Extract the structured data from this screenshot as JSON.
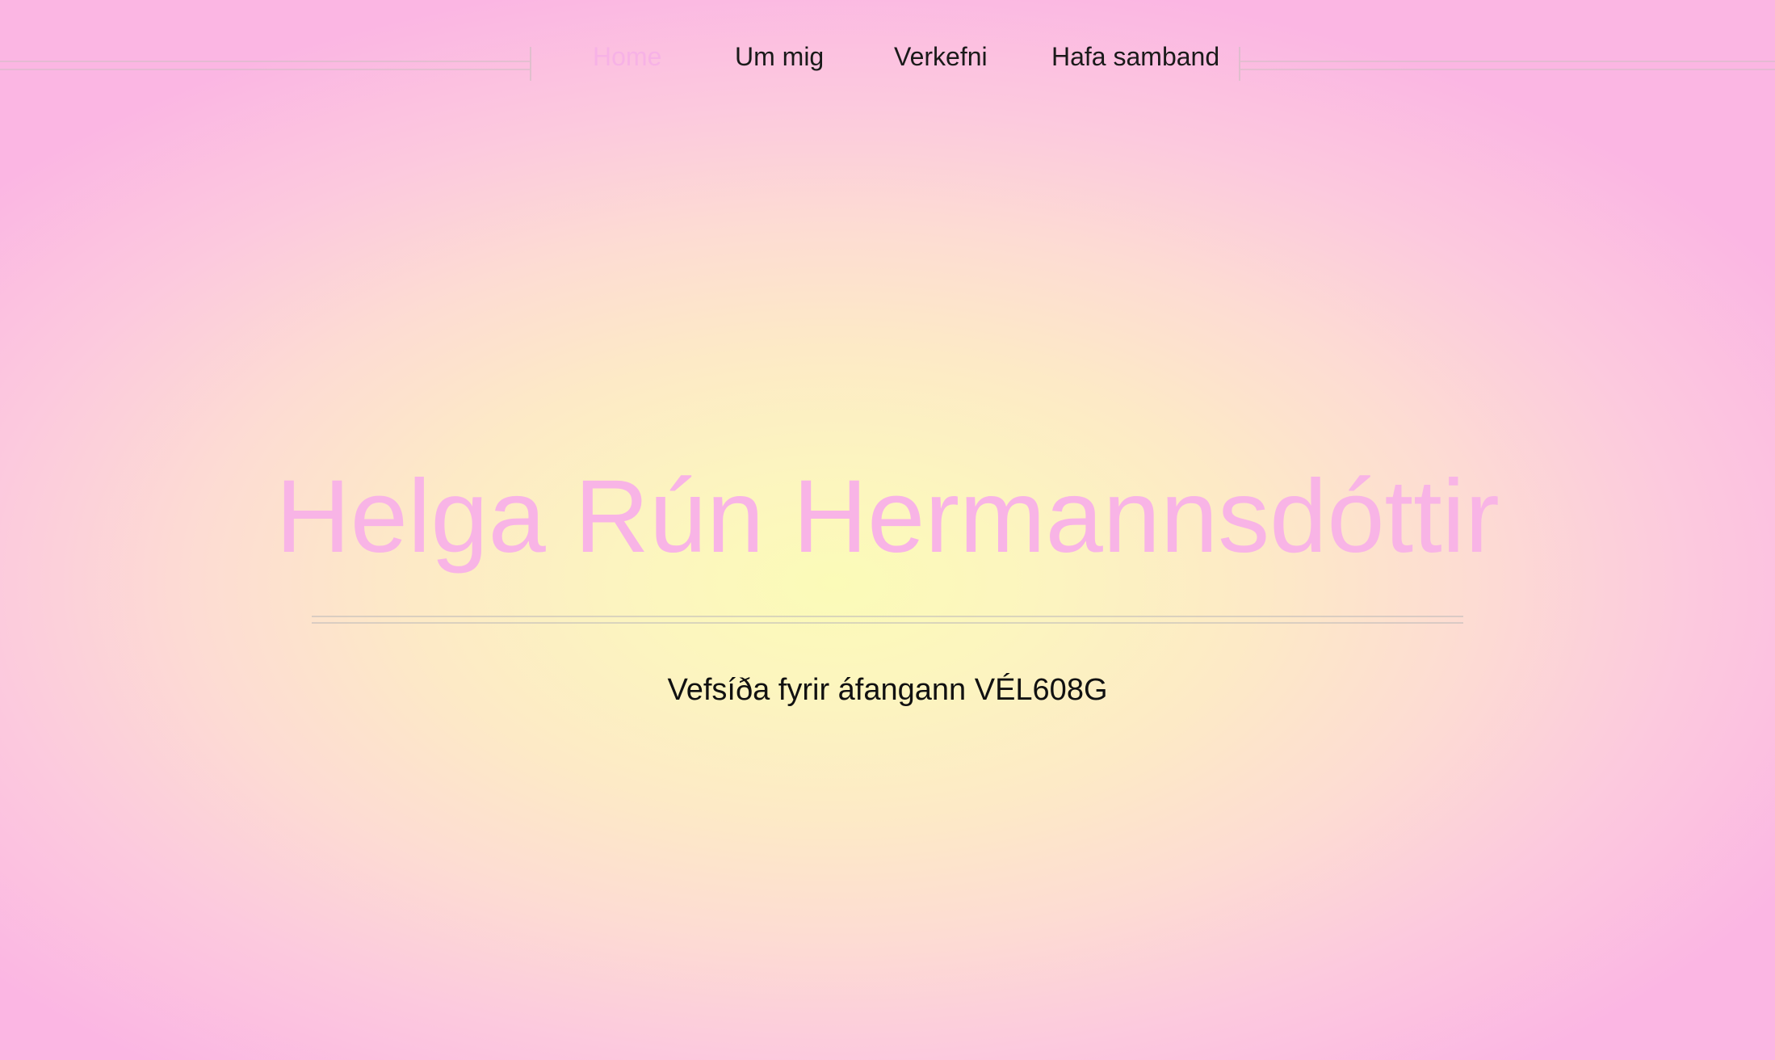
{
  "nav": {
    "items": [
      {
        "label": "Home",
        "active": true
      },
      {
        "label": "Um mig",
        "active": false
      },
      {
        "label": "Verkefni",
        "active": false
      },
      {
        "label": "Hafa samband",
        "active": false
      }
    ]
  },
  "hero": {
    "title": "Helga Rún Hermannsdóttir",
    "subtitle": "Vefsíða fyrir áfangann VÉL608G"
  },
  "colors": {
    "accent_pink": "#f8b4e6",
    "background_center": "#fbfbb8",
    "background_edge": "#fbb6e3",
    "text": "#111111"
  }
}
